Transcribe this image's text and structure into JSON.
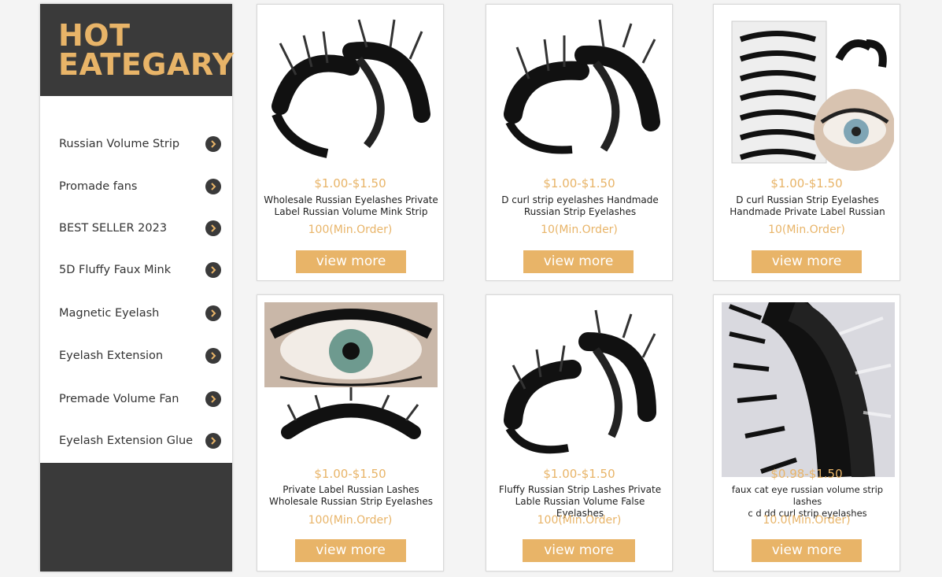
{
  "sidebar": {
    "title_line1": "HOT",
    "title_line2": "EATEGARY",
    "items": [
      {
        "label": "Russian Volume Strip"
      },
      {
        "label": "Promade fans"
      },
      {
        "label": "BEST SELLER 2023"
      },
      {
        "label": "5D Fluffy Faux Mink"
      },
      {
        "label": "Magnetic Eyelash"
      },
      {
        "label": "Eyelash Extension"
      },
      {
        "label": "Premade Volume Fan"
      },
      {
        "label": "Eyelash Extension Glue"
      }
    ]
  },
  "products": [
    {
      "price": "$1.00-$1.50",
      "name_line1": "Wholesale Russian Eyelashes Private",
      "name_line2": "Label Russian Volume Mink Strip",
      "min_order": "100(Min.Order)",
      "button": "view more",
      "image": "lash-strip-pair"
    },
    {
      "price": "$1.00-$1.50",
      "name_line1": "D curl strip eyelashes Handmade",
      "name_line2": "Russian Strip Eyelashes",
      "min_order": "10(Min.Order)",
      "button": "view more",
      "image": "lash-strip-pair"
    },
    {
      "price": "$1.00-$1.50",
      "name_line1": "D curl Russian Strip Eyelashes",
      "name_line2": "Handmade Private Label Russian",
      "min_order": "10(Min.Order)",
      "button": "view more",
      "image": "lash-tray-with-eye"
    },
    {
      "price": "$1.00-$1.50",
      "name_line1": "Private Label Russian Lashes",
      "name_line2": "Wholesale Russian Strip Eyelashes",
      "min_order": "100(Min.Order)",
      "button": "view more",
      "image": "eye-closeup-with-strip"
    },
    {
      "price": "$1.00-$1.50",
      "name_line1": "Fluffy Russian Strip Lashes Private",
      "name_line2": "Lable Russian Volume False Eyelashes",
      "min_order": "100(Min.Order)",
      "button": "view more",
      "image": "lash-strip-pair"
    },
    {
      "price": "$0.98-$1.50",
      "name_line1": "faux cat eye russian volume strip lashes",
      "name_line2": "c d dd curl strip eyelashes",
      "min_order": "10.0(Min.Order)",
      "button": "view more",
      "image": "lash-strip-closeup"
    }
  ]
}
